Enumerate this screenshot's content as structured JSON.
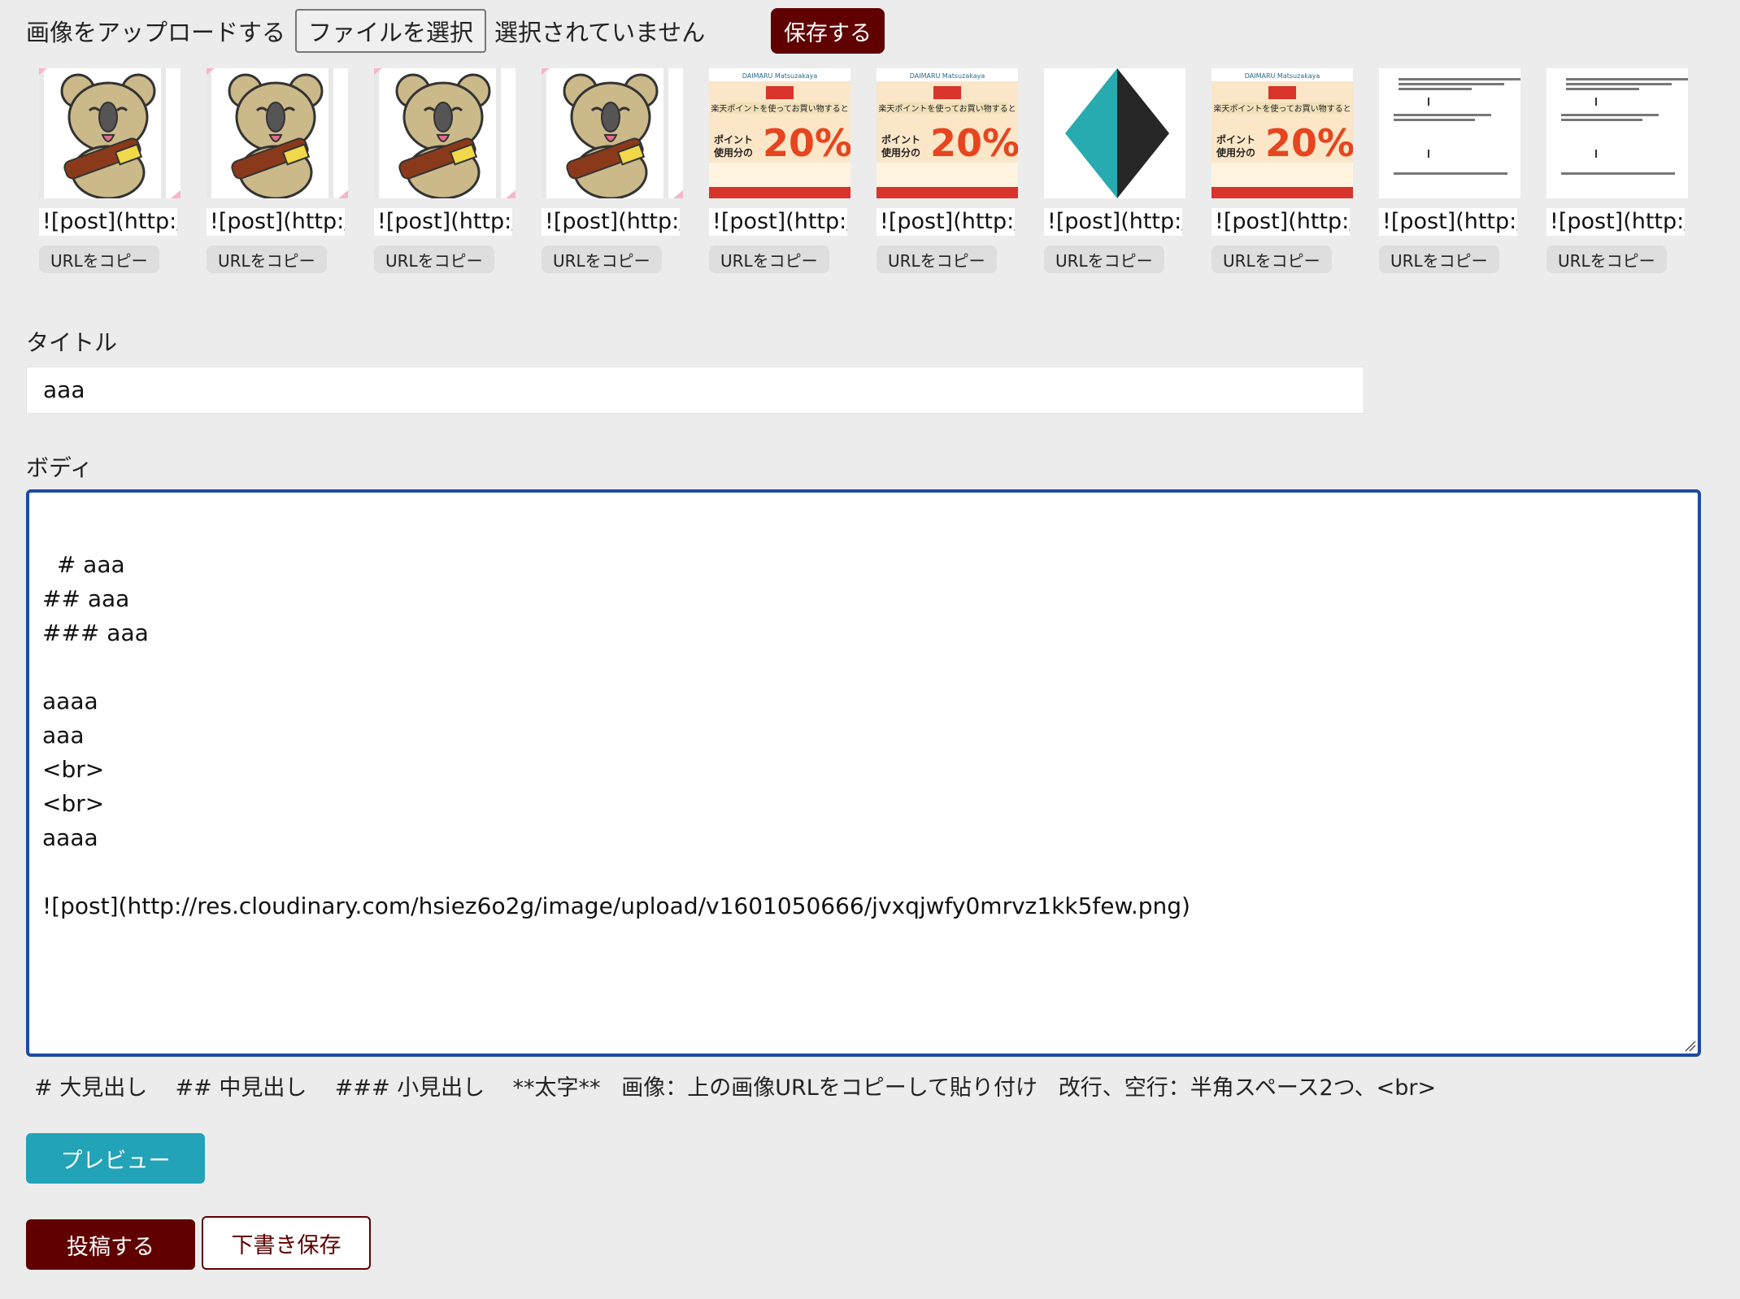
{
  "upload": {
    "label": "画像をアップロードする",
    "file_button": "ファイルを選択",
    "no_file": "選択されていません",
    "save_button": "保存する"
  },
  "gallery": [
    {
      "image": "koala-illustration",
      "url_text": "![post](http://",
      "copy_label": "URLをコピー"
    },
    {
      "image": "koala-illustration",
      "url_text": "![post](http://",
      "copy_label": "URLをコピー"
    },
    {
      "image": "koala-illustration",
      "url_text": "![post](http://",
      "copy_label": "URLをコピー"
    },
    {
      "image": "koala-illustration",
      "url_text": "![post](http://",
      "copy_label": "URLをコピー"
    },
    {
      "image": "rakuten-point-banner",
      "url_text": "![post](http://",
      "copy_label": "URLをコピー"
    },
    {
      "image": "rakuten-point-banner",
      "url_text": "![post](http://",
      "copy_label": "URLをコピー"
    },
    {
      "image": "teal-black-diamond",
      "url_text": "![post](http://",
      "copy_label": "URLをコピー"
    },
    {
      "image": "rakuten-point-banner",
      "url_text": "![post](http://",
      "copy_label": "URLをコピー"
    },
    {
      "image": "text-document",
      "url_text": "![post](http://",
      "copy_label": "URLをコピー"
    },
    {
      "image": "text-document",
      "url_text": "![post](http://",
      "copy_label": "URLをコピー"
    }
  ],
  "banner": {
    "brand": "DAIMARU  Matsuzakaya",
    "headline": "楽天ポイントを使ってお買い物すると",
    "percent": "20%",
    "sub1": "ポイント",
    "sub2": "使用分の"
  },
  "title_field": {
    "label": "タイトル",
    "value": "aaa"
  },
  "body_field": {
    "label": "ボディ",
    "value": "# aaa\n## aaa\n### aaa\n\naaaa\naaa\n<br>\n<br>\naaaa\n\n![post](http://res.cloudinary.com/hsiez6o2g/image/upload/v1601050666/jvxqjwfy0mrvz1kk5few.png)"
  },
  "hint": "# 大見出し    ## 中見出し    ### 小見出し    **太字**   画像：上の画像URLをコピーして貼り付け   改行、空行：半角スペース2つ、<br>",
  "buttons": {
    "preview": "プレビュー",
    "post": "投稿する",
    "draft": "下書き保存"
  },
  "colors": {
    "primary_dark_red": "#600000",
    "preview_teal": "#22a3b7",
    "focus_blue": "#1d4ba3",
    "background": "#ececec"
  }
}
